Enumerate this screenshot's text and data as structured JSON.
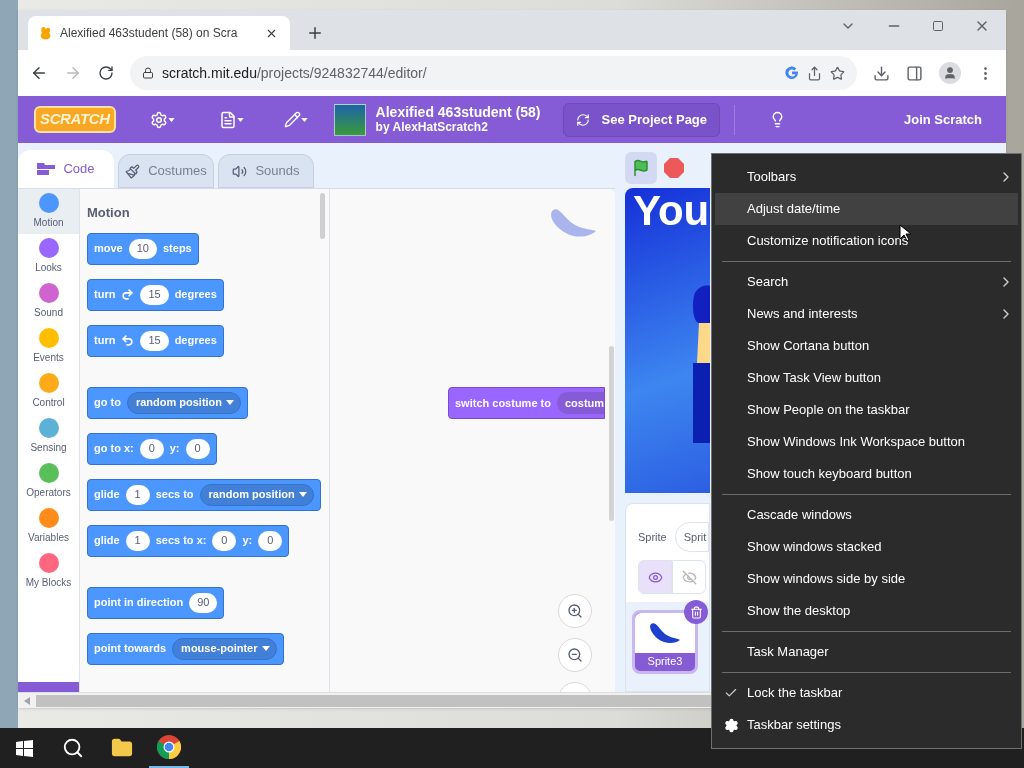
{
  "browser": {
    "tab_title": "Alexified 463student (58) on Scra",
    "url_host": "scratch.mit.edu",
    "url_path": "/projects/924832744/editor/"
  },
  "scratch_header": {
    "logo_text": "SCRATCH",
    "project_title": "Alexified 463student (58)",
    "author": "by AlexHatScratch2",
    "see_project_button": "See Project Page",
    "join_button": "Join Scratch"
  },
  "editor_tabs": [
    {
      "label": "Code",
      "kind": "code",
      "selected": true
    },
    {
      "label": "Costumes",
      "kind": "costumes",
      "selected": false
    },
    {
      "label": "Sounds",
      "kind": "sounds",
      "selected": false
    }
  ],
  "categories": [
    {
      "label": "Motion",
      "color": "#4c97ff",
      "selected": true
    },
    {
      "label": "Looks",
      "color": "#9966ff",
      "selected": false
    },
    {
      "label": "Sound",
      "color": "#cf63cf",
      "selected": false
    },
    {
      "label": "Events",
      "color": "#ffbf00",
      "selected": false
    },
    {
      "label": "Control",
      "color": "#ffab19",
      "selected": false
    },
    {
      "label": "Sensing",
      "color": "#5cb1d6",
      "selected": false
    },
    {
      "label": "Operators",
      "color": "#59c059",
      "selected": false
    },
    {
      "label": "Variables",
      "color": "#ff8c1a",
      "selected": false
    },
    {
      "label": "My Blocks",
      "color": "#ff6680",
      "selected": false
    }
  ],
  "palette": {
    "heading": "Motion",
    "groups": [
      [
        [
          {
            "kind": "text",
            "text": "move"
          },
          {
            "kind": "number",
            "text": "10"
          },
          {
            "kind": "text",
            "text": "steps"
          }
        ],
        [
          {
            "kind": "text",
            "text": "turn"
          },
          {
            "kind": "rotate_right"
          },
          {
            "kind": "number",
            "text": "15"
          },
          {
            "kind": "text",
            "text": "degrees"
          }
        ],
        [
          {
            "kind": "text",
            "text": "turn"
          },
          {
            "kind": "rotate_left"
          },
          {
            "kind": "number",
            "text": "15"
          },
          {
            "kind": "text",
            "text": "degrees"
          }
        ]
      ],
      [
        [
          {
            "kind": "text",
            "text": "go to"
          },
          {
            "kind": "dropdown",
            "text": "random position"
          }
        ],
        [
          {
            "kind": "text",
            "text": "go to x:"
          },
          {
            "kind": "number",
            "text": "0"
          },
          {
            "kind": "text",
            "text": "y:"
          },
          {
            "kind": "number",
            "text": "0"
          }
        ],
        [
          {
            "kind": "text",
            "text": "glide"
          },
          {
            "kind": "number",
            "text": "1"
          },
          {
            "kind": "text",
            "text": "secs to"
          },
          {
            "kind": "dropdown",
            "text": "random position"
          }
        ],
        [
          {
            "kind": "text",
            "text": "glide"
          },
          {
            "kind": "number",
            "text": "1"
          },
          {
            "kind": "text",
            "text": "secs to x:"
          },
          {
            "kind": "number",
            "text": "0"
          },
          {
            "kind": "text",
            "text": "y:"
          },
          {
            "kind": "number",
            "text": "0"
          }
        ]
      ],
      [
        [
          {
            "kind": "text",
            "text": "point in direction"
          },
          {
            "kind": "number",
            "text": "90"
          }
        ],
        [
          {
            "kind": "text",
            "text": "point towards"
          },
          {
            "kind": "dropdown",
            "text": "mouse-pointer"
          }
        ]
      ]
    ]
  },
  "script_block": [
    {
      "kind": "text",
      "text": "switch costume to"
    },
    {
      "kind": "menu",
      "text": "costum"
    }
  ],
  "stage": {
    "banner_text": "You"
  },
  "sprite_pane": {
    "sprite_label": "Sprite",
    "name_value": "Sprit",
    "visible": true,
    "sprites": [
      {
        "name": "Sprite3",
        "selected": true
      }
    ]
  },
  "context_menu": [
    [
      {
        "label": "Toolbars",
        "kind": "submenu",
        "selected": false,
        "checked": false
      },
      {
        "label": "Adjust date/time",
        "kind": "plain",
        "selected": true,
        "checked": false
      },
      {
        "label": "Customize notification icons",
        "kind": "plain",
        "selected": false,
        "checked": false
      }
    ],
    [
      {
        "label": "Search",
        "kind": "submenu",
        "selected": false,
        "checked": false
      },
      {
        "label": "News and interests",
        "kind": "submenu",
        "selected": false,
        "checked": false
      },
      {
        "label": "Show Cortana button",
        "kind": "plain",
        "selected": false,
        "checked": false
      },
      {
        "label": "Show Task View button",
        "kind": "plain",
        "selected": false,
        "checked": false
      },
      {
        "label": "Show People on the taskbar",
        "kind": "plain",
        "selected": false,
        "checked": false
      },
      {
        "label": "Show Windows Ink Workspace button",
        "kind": "plain",
        "selected": false,
        "checked": false
      },
      {
        "label": "Show touch keyboard button",
        "kind": "plain",
        "selected": false,
        "checked": false
      }
    ],
    [
      {
        "label": "Cascade windows",
        "kind": "plain",
        "selected": false,
        "checked": false
      },
      {
        "label": "Show windows stacked",
        "kind": "plain",
        "selected": false,
        "checked": false
      },
      {
        "label": "Show windows side by side",
        "kind": "plain",
        "selected": false,
        "checked": false
      },
      {
        "label": "Show the desktop",
        "kind": "plain",
        "selected": false,
        "checked": false
      }
    ],
    [
      {
        "label": "Task Manager",
        "kind": "plain",
        "selected": false,
        "checked": false
      }
    ],
    [
      {
        "label": "Lock the taskbar",
        "kind": "plain",
        "selected": false,
        "checked": true
      },
      {
        "label": "Taskbar settings",
        "kind": "settings",
        "selected": false,
        "checked": false
      }
    ]
  ]
}
